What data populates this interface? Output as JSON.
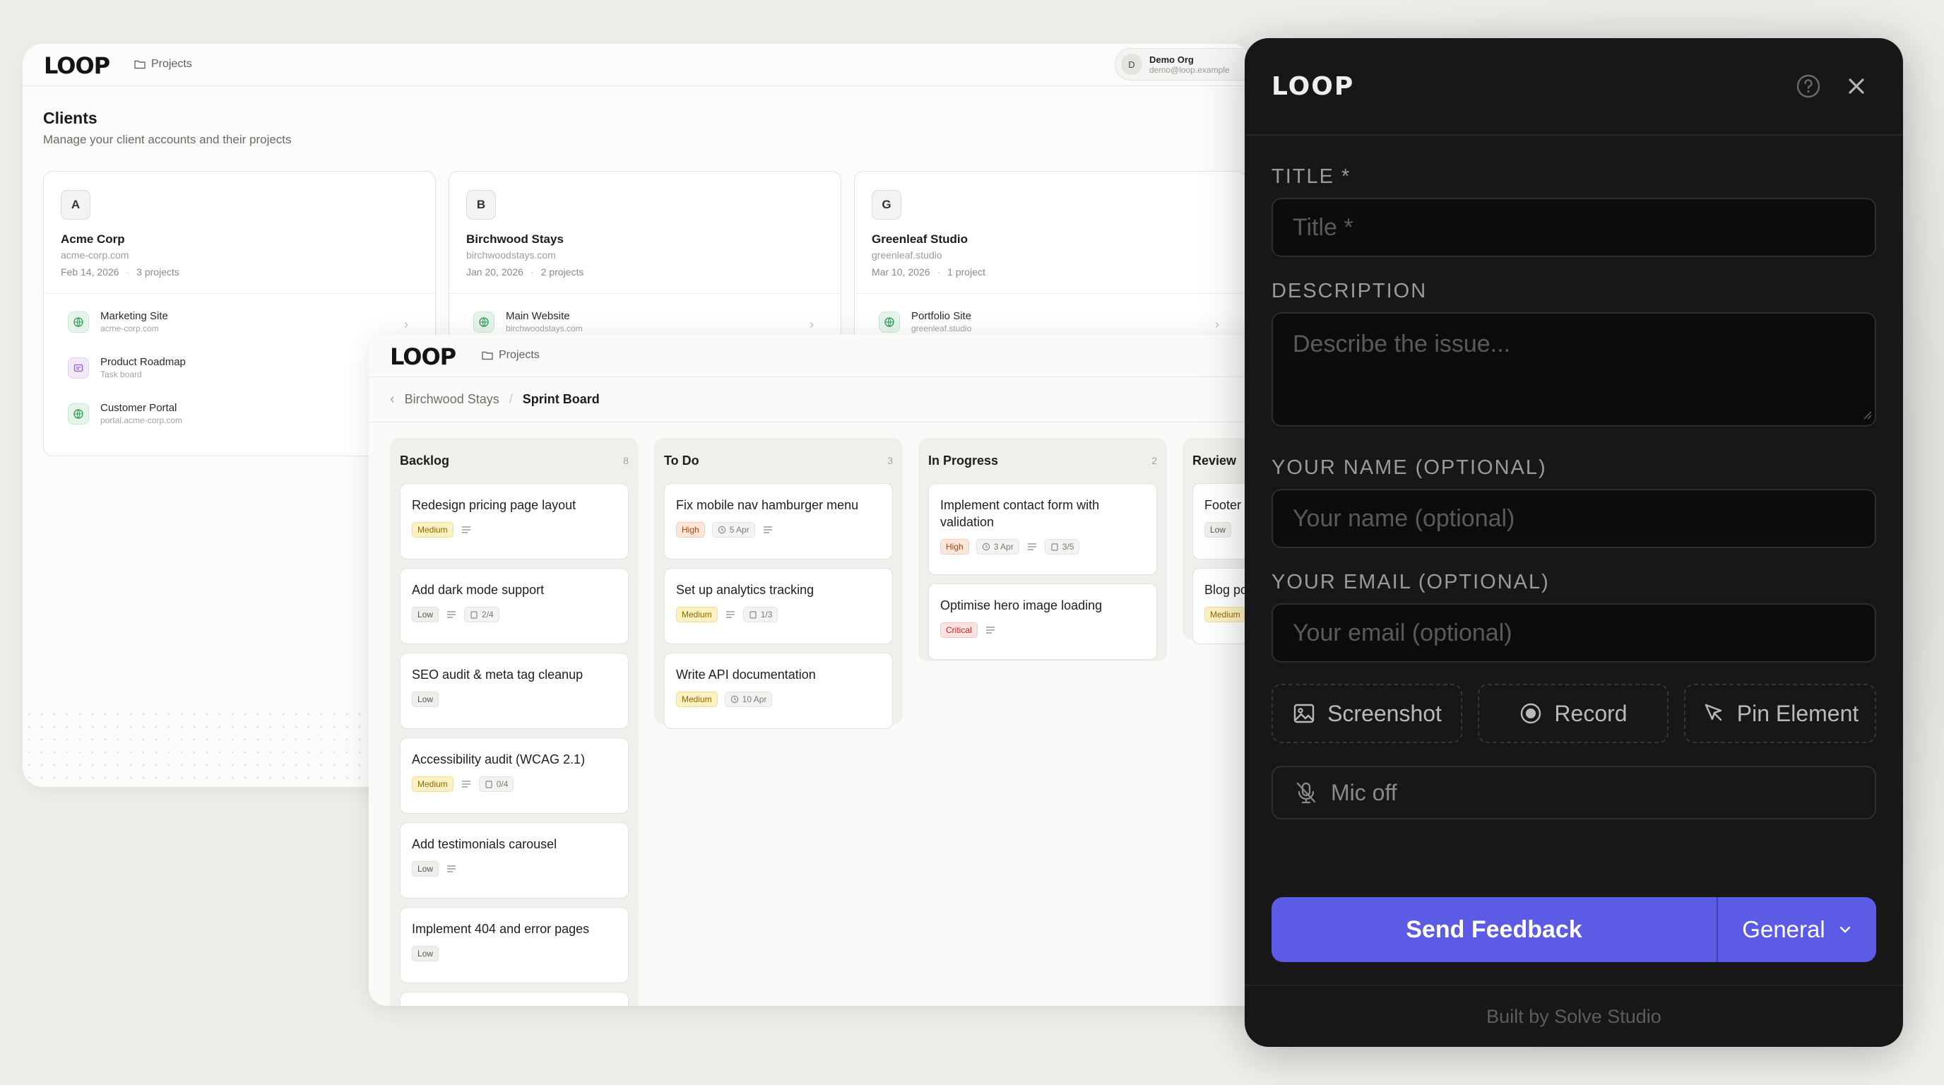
{
  "clients_window": {
    "logo": "LOOP",
    "nav_projects": "Projects",
    "user": {
      "initial": "D",
      "org": "Demo Org",
      "email": "demo@loop.example"
    },
    "title": "Clients",
    "subtitle": "Manage your client accounts and their projects",
    "clients": [
      {
        "initial": "A",
        "name": "Acme Corp",
        "domain": "acme-corp.com",
        "date": "Feb 14, 2026",
        "project_count": "3 projects",
        "projects": [
          {
            "name": "Marketing Site",
            "sub": "acme-corp.com",
            "icon": "globe-icon"
          },
          {
            "name": "Product Roadmap",
            "sub": "Task board",
            "icon": "board-icon"
          },
          {
            "name": "Customer Portal",
            "sub": "portal.acme-corp.com",
            "icon": "globe-icon"
          }
        ]
      },
      {
        "initial": "B",
        "name": "Birchwood Stays",
        "domain": "birchwoodstays.com",
        "date": "Jan 20, 2026",
        "project_count": "2 projects",
        "projects": [
          {
            "name": "Main Website",
            "sub": "birchwoodstays.com",
            "icon": "globe-icon"
          }
        ]
      },
      {
        "initial": "G",
        "name": "Greenleaf Studio",
        "domain": "greenleaf.studio",
        "date": "Mar 10, 2026",
        "project_count": "1 project",
        "projects": [
          {
            "name": "Portfolio Site",
            "sub": "greenleaf.studio",
            "icon": "globe-icon"
          }
        ]
      }
    ]
  },
  "board_window": {
    "logo": "LOOP",
    "nav_projects": "Projects",
    "breadcrumb": {
      "parent": "Birchwood Stays",
      "current": "Sprint Board"
    },
    "columns": [
      {
        "name": "Backlog",
        "count": "8",
        "tasks": [
          {
            "title": "Redesign pricing page layout",
            "priority": "Medium"
          },
          {
            "title": "Add dark mode support",
            "priority": "Low",
            "subtasks": "2/4"
          },
          {
            "title": "SEO audit & meta tag cleanup",
            "priority": "Low"
          },
          {
            "title": "Accessibility audit (WCAG 2.1)",
            "priority": "Medium",
            "subtasks": "0/4"
          },
          {
            "title": "Add testimonials carousel",
            "priority": "Low"
          },
          {
            "title": "Implement 404 and error pages",
            "priority": "Low"
          }
        ]
      },
      {
        "name": "To Do",
        "count": "3",
        "tasks": [
          {
            "title": "Fix mobile nav hamburger menu",
            "priority": "High",
            "due": "5 Apr"
          },
          {
            "title": "Set up analytics tracking",
            "priority": "Medium",
            "subtasks": "1/3"
          },
          {
            "title": "Write API documentation",
            "priority": "Medium",
            "due": "10 Apr"
          }
        ]
      },
      {
        "name": "In Progress",
        "count": "2",
        "tasks": [
          {
            "title": "Implement contact form with validation",
            "priority": "High",
            "due": "3 Apr",
            "subtasks": "3/5"
          },
          {
            "title": "Optimise hero image loading",
            "priority": "Critical"
          }
        ]
      },
      {
        "name": "Review",
        "count": "",
        "tasks": [
          {
            "title": "Footer",
            "priority": "Low"
          },
          {
            "title": "Blog po",
            "priority": "Medium"
          }
        ]
      }
    ]
  },
  "feedback_panel": {
    "logo": "LOOP",
    "title_label": "TITLE *",
    "title_placeholder": "Title *",
    "description_label": "DESCRIPTION",
    "description_placeholder": "Describe the issue...",
    "name_label": "YOUR NAME (OPTIONAL)",
    "name_placeholder": "Your name (optional)",
    "email_label": "YOUR EMAIL (OPTIONAL)",
    "email_placeholder": "Your email (optional)",
    "screenshot_label": "Screenshot",
    "record_label": "Record",
    "pin_label": "Pin Element",
    "mic_label": "Mic off",
    "send_label": "Send Feedback",
    "type_label": "General",
    "footer": "Built by Solve Studio",
    "accent_color": "#5b5be6"
  }
}
